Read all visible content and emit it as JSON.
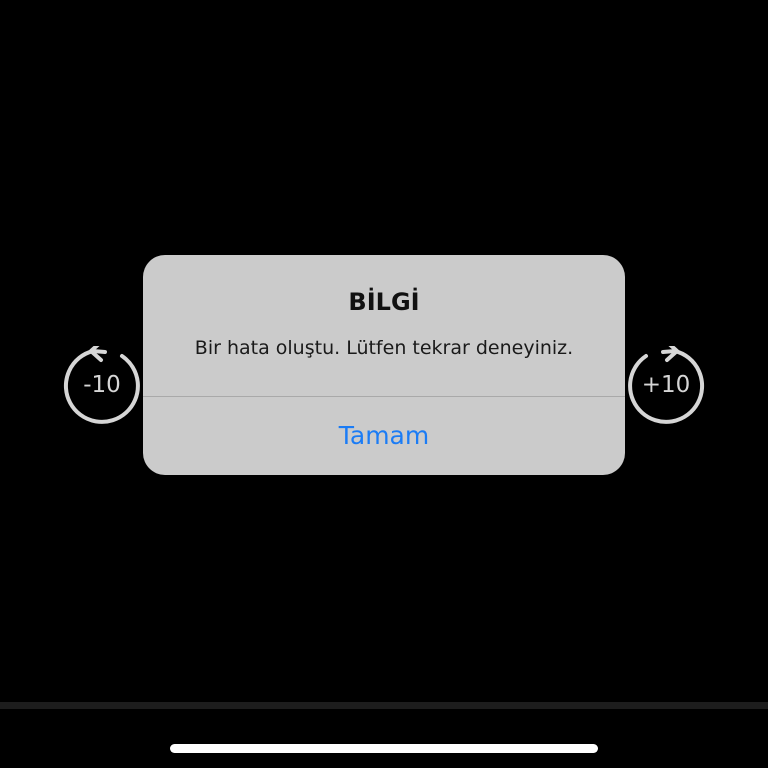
{
  "player": {
    "skip_back_label": "-10",
    "skip_forward_label": "+10"
  },
  "alert": {
    "title": "BİLGİ",
    "message": "Bir hata oluştu. Lütfen tekrar deneyiniz.",
    "ok_button": "Tamam"
  },
  "colors": {
    "background": "#000000",
    "alert_bg": "#cbcbcb",
    "accent": "#1b7cf5",
    "control": "#d6d6d6"
  },
  "icons": {
    "skip_back": "rotate-ccw-icon",
    "skip_forward": "rotate-cw-icon"
  }
}
